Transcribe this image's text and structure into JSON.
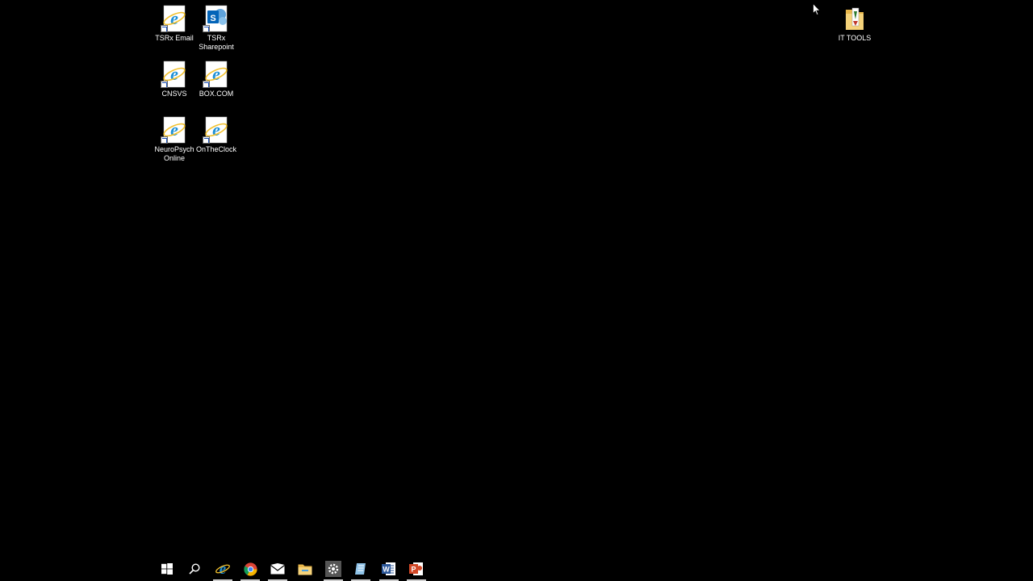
{
  "desktop": {
    "icons": [
      {
        "label": "TSRx Email",
        "icon": "internet-explorer-icon"
      },
      {
        "label": "TSRx Sharepoint",
        "icon": "sharepoint-icon"
      },
      {
        "label": "CNSVS",
        "icon": "internet-explorer-icon"
      },
      {
        "label": "BOX.COM",
        "icon": "internet-explorer-icon"
      },
      {
        "label": "NeuroPsych Online",
        "icon": "internet-explorer-icon"
      },
      {
        "label": "OnTheClock",
        "icon": "internet-explorer-icon"
      },
      {
        "label": "IT TOOLS",
        "icon": "folder-icon"
      }
    ]
  },
  "taskbar": {
    "items": [
      {
        "name": "start",
        "icon": "windows-start-icon"
      },
      {
        "name": "search",
        "icon": "search-icon"
      },
      {
        "name": "internet-explorer",
        "icon": "internet-explorer-icon"
      },
      {
        "name": "chrome",
        "icon": "chrome-icon"
      },
      {
        "name": "mail",
        "icon": "mail-icon"
      },
      {
        "name": "file-explorer",
        "icon": "folder-icon"
      },
      {
        "name": "settings",
        "icon": "gear-icon"
      },
      {
        "name": "app",
        "icon": "notepad-icon"
      },
      {
        "name": "word",
        "icon": "word-icon"
      },
      {
        "name": "powerpoint",
        "icon": "powerpoint-icon"
      }
    ]
  },
  "colors": {
    "background": "#000000",
    "ie_blue": "#1e90d6",
    "ie_gold": "#f2c12e",
    "sharepoint_blue": "#0364b8",
    "word_blue": "#2b579a",
    "powerpoint_red": "#d24726"
  }
}
